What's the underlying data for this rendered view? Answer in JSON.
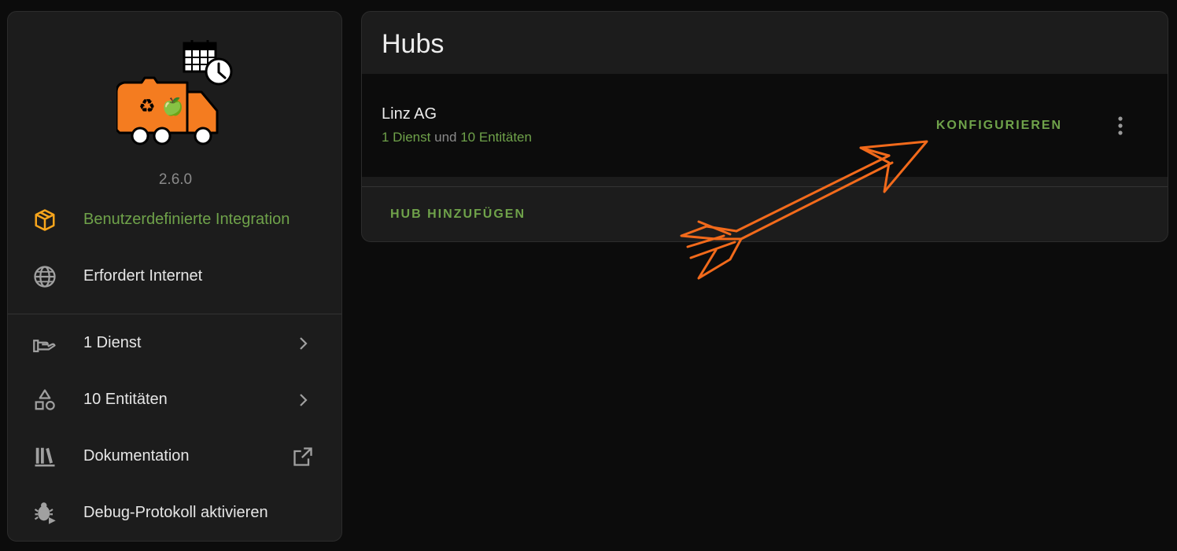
{
  "integration": {
    "version": "2.6.0",
    "logo_icon": "garbage-truck-calendar-logo",
    "rows": [
      {
        "icon": "package-icon",
        "label": "Benutzerdefinierte Integration",
        "accent": true
      },
      {
        "icon": "globe-icon",
        "label": "Erfordert Internet"
      },
      {
        "icon": "hand-service-icon",
        "label": "1 Dienst",
        "trail": "chevron-right-icon"
      },
      {
        "icon": "shapes-icon",
        "label": "10 Entitäten",
        "trail": "chevron-right-icon"
      },
      {
        "icon": "bookshelf-icon",
        "label": "Dokumentation",
        "trail": "open-in-new-icon"
      },
      {
        "icon": "bug-play-icon",
        "label": "Debug-Protokoll aktivieren"
      }
    ]
  },
  "hubs": {
    "title": "Hubs",
    "entries": [
      {
        "name": "Linz AG",
        "services_link": "1 Dienst",
        "conjunction": "und",
        "entities_link": "10 Entitäten",
        "configure_label": "KONFIGURIEREN"
      }
    ],
    "add_label": "HUB HINZUFÜGEN"
  },
  "colors": {
    "accent_green": "#6fa24a",
    "icon_orange": "#f7a51c",
    "arrow_orange": "#f26a1b",
    "card_bg": "#1c1c1c",
    "page_bg": "#0c0c0c"
  }
}
